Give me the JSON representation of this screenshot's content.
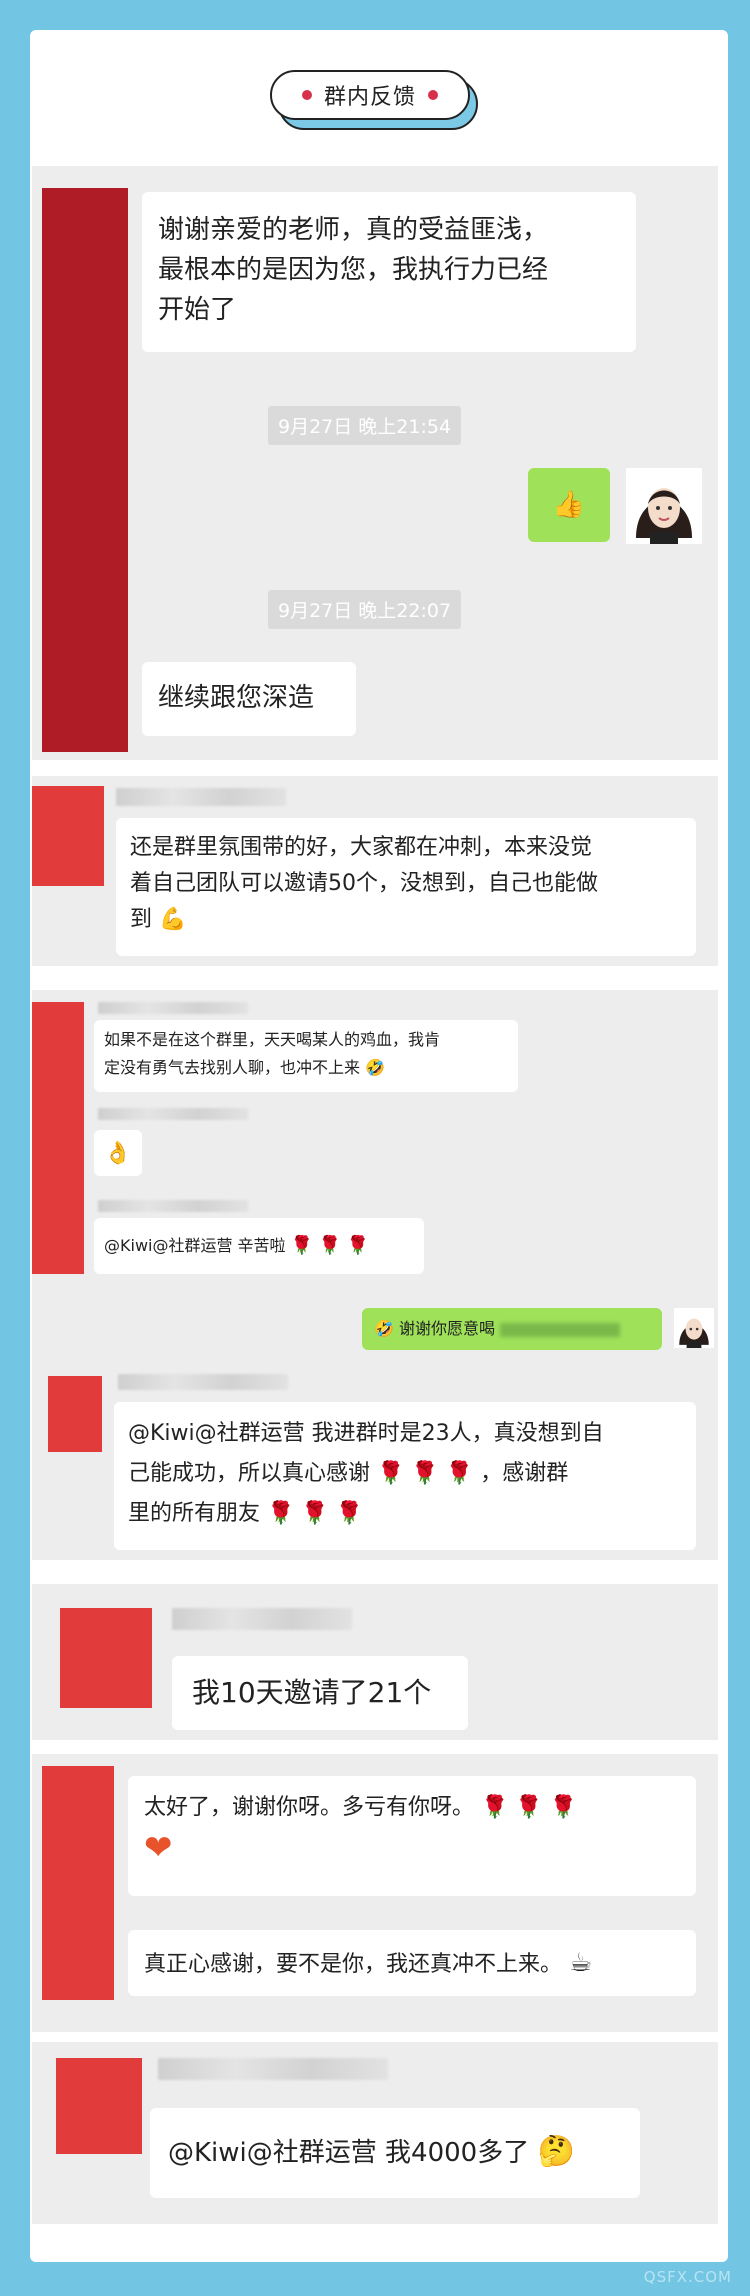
{
  "header": {
    "title": "群内反馈"
  },
  "colors": {
    "page_bg": "#72c6e4",
    "panel_bg": "#ededed",
    "mask_red": "#e23b3b",
    "mask_darkred": "#b01c25",
    "bubble_green": "#9fe25a"
  },
  "chat1": {
    "msg1": "谢谢亲爱的老师，真的受益匪浅，最根本的是因为您，我执行力已经开始了",
    "msg1_l1": "谢谢亲爱的老师，真的受益匪浅，",
    "msg1_l2": "最根本的是因为您，我执行力已经",
    "msg1_l3": "开始了",
    "ts1": "9月27日 晚上21:54",
    "reply_icon": "thumbs-up-icon",
    "ts2": "9月27日 晚上22:07",
    "msg2": "继续跟您深造"
  },
  "chat2": {
    "l1": "还是群里氛围带的好，大家都在冲刺，本来没觉",
    "l2": "着自己团队可以邀请50个，没想到，自己也能做",
    "l3": "到",
    "emoji": "💪"
  },
  "chat3": {
    "m1_l1": "如果不是在这个群里，天天喝某人的鸡血，我肯",
    "m1_l2": "定没有勇气去找别人聊，也冲不上来",
    "m1_emoji": "🤣",
    "m2_emoji": "👌",
    "m3": "@Kiwi@社群运营 辛苦啦",
    "m3_roses": "🌹 🌹 🌹",
    "reply": "谢谢你愿意喝",
    "reply_emoji": "🤣",
    "m4_l1": "@Kiwi@社群运营 我进群时是23人，真没想到自",
    "m4_l2a": "己能成功，所以真心感谢",
    "m4_l2b": "，感谢群",
    "m4_l3": "里的所有朋友",
    "roses": "🌹 🌹 🌹"
  },
  "chat4": {
    "msg": "我10天邀请了21个"
  },
  "chat5": {
    "m1": "太好了，谢谢你呀。多亏有你呀。",
    "m1_roses": "🌹 🌹 🌹",
    "m1_heart": "❤",
    "m2": "真正心感谢，要不是你，我还真冲不上来。",
    "m2_emoji": "☕"
  },
  "chat6": {
    "msg": "@Kiwi@社群运营 我4000多了",
    "emoji": "🤔"
  },
  "watermark": "QSFX.COM"
}
